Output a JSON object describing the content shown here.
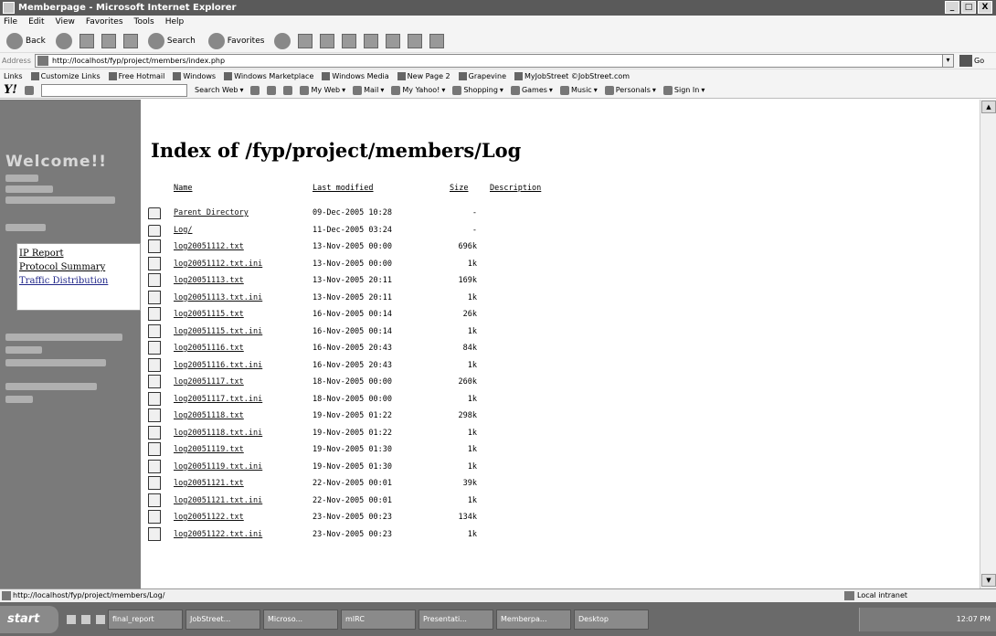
{
  "window": {
    "title": "Memberpage - Microsoft Internet Explorer",
    "buttons": [
      "_",
      "□",
      "X"
    ]
  },
  "menubar": [
    "File",
    "Edit",
    "View",
    "Favorites",
    "Tools",
    "Help"
  ],
  "toolbar": {
    "back": "Back",
    "search": "Search",
    "favorites": "Favorites"
  },
  "addressbar": {
    "label": "Address",
    "url": "http://localhost/fyp/project/members/index.php",
    "go": "Go"
  },
  "linksbar": {
    "label": "Links",
    "items": [
      "Customize Links",
      "Free Hotmail",
      "Windows",
      "Windows Marketplace",
      "Windows Media",
      "New Page 2",
      "Grapevine",
      "MyJobStreet ©JobStreet.com"
    ]
  },
  "yahoobar": {
    "logo": "Y!",
    "search_web": "Search Web",
    "items": [
      "My Web",
      "Mail",
      "My Yahoo!",
      "Shopping",
      "Games",
      "Music",
      "Personals",
      "Sign In"
    ]
  },
  "sidebar": {
    "welcome": "Welcome!!",
    "menu": [
      "IP Report",
      "Protocol Summary",
      "Traffic Distribution"
    ]
  },
  "page": {
    "heading": "Index of /fyp/project/members/Log",
    "columns": {
      "name": "Name",
      "modified": "Last modified",
      "size": "Size",
      "description": "Description"
    },
    "rows": [
      {
        "icon": "folder-icon",
        "name": "Parent Directory",
        "modified": "09-Dec-2005 10:28",
        "size": "-"
      },
      {
        "icon": "folder-icon",
        "name": "Log/",
        "modified": "11-Dec-2005 03:24",
        "size": "-"
      },
      {
        "icon": "file-icon",
        "name": "log20051112.txt",
        "modified": "13-Nov-2005 00:00",
        "size": "696k"
      },
      {
        "icon": "file-icon",
        "name": "log20051112.txt.ini",
        "modified": "13-Nov-2005 00:00",
        "size": "1k"
      },
      {
        "icon": "file-icon",
        "name": "log20051113.txt",
        "modified": "13-Nov-2005 20:11",
        "size": "169k"
      },
      {
        "icon": "file-icon",
        "name": "log20051113.txt.ini",
        "modified": "13-Nov-2005 20:11",
        "size": "1k"
      },
      {
        "icon": "file-icon",
        "name": "log20051115.txt",
        "modified": "16-Nov-2005 00:14",
        "size": "26k"
      },
      {
        "icon": "file-icon",
        "name": "log20051115.txt.ini",
        "modified": "16-Nov-2005 00:14",
        "size": "1k"
      },
      {
        "icon": "file-icon",
        "name": "log20051116.txt",
        "modified": "16-Nov-2005 20:43",
        "size": "84k"
      },
      {
        "icon": "file-icon",
        "name": "log20051116.txt.ini",
        "modified": "16-Nov-2005 20:43",
        "size": "1k"
      },
      {
        "icon": "file-icon",
        "name": "log20051117.txt",
        "modified": "18-Nov-2005 00:00",
        "size": "260k"
      },
      {
        "icon": "file-icon",
        "name": "log20051117.txt.ini",
        "modified": "18-Nov-2005 00:00",
        "size": "1k"
      },
      {
        "icon": "file-icon",
        "name": "log20051118.txt",
        "modified": "19-Nov-2005 01:22",
        "size": "298k"
      },
      {
        "icon": "file-icon",
        "name": "log20051118.txt.ini",
        "modified": "19-Nov-2005 01:22",
        "size": "1k"
      },
      {
        "icon": "file-icon",
        "name": "log20051119.txt",
        "modified": "19-Nov-2005 01:30",
        "size": "1k"
      },
      {
        "icon": "file-icon",
        "name": "log20051119.txt.ini",
        "modified": "19-Nov-2005 01:30",
        "size": "1k"
      },
      {
        "icon": "file-icon",
        "name": "log20051121.txt",
        "modified": "22-Nov-2005 00:01",
        "size": "39k"
      },
      {
        "icon": "file-icon",
        "name": "log20051121.txt.ini",
        "modified": "22-Nov-2005 00:01",
        "size": "1k"
      },
      {
        "icon": "file-icon",
        "name": "log20051122.txt",
        "modified": "23-Nov-2005 00:23",
        "size": "134k"
      },
      {
        "icon": "file-icon",
        "name": "log20051122.txt.ini",
        "modified": "23-Nov-2005 00:23",
        "size": "1k"
      }
    ]
  },
  "statusbar": {
    "url": "http://localhost/fyp/project/members/Log/",
    "zone": "Local intranet"
  },
  "taskbar": {
    "start": "start",
    "tasks": [
      "final_report",
      "JobStreet...",
      "Microso...",
      "mIRC",
      "Presentati...",
      "Memberpa...",
      "Desktop"
    ],
    "clock": "12:07 PM"
  }
}
